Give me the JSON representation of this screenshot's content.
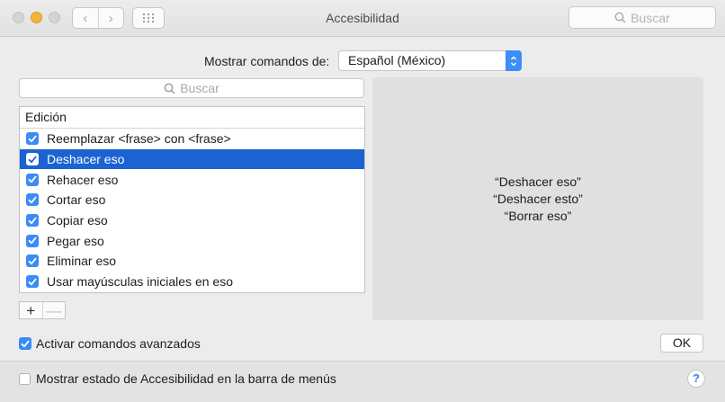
{
  "window": {
    "title": "Accesibilidad"
  },
  "toolbar": {
    "search_placeholder": "Buscar",
    "back_label": "‹",
    "forward_label": "›"
  },
  "commands": {
    "label": "Mostrar comandos de:",
    "language": "Español (México)"
  },
  "list_search": {
    "placeholder": "Buscar"
  },
  "list": {
    "header": "Edición",
    "items": [
      {
        "label": "Reemplazar <frase> con <frase>",
        "checked": true,
        "selected": false
      },
      {
        "label": "Deshacer eso",
        "checked": true,
        "selected": true
      },
      {
        "label": "Rehacer eso",
        "checked": true,
        "selected": false
      },
      {
        "label": "Cortar eso",
        "checked": true,
        "selected": false
      },
      {
        "label": "Copiar eso",
        "checked": true,
        "selected": false
      },
      {
        "label": "Pegar eso",
        "checked": true,
        "selected": false
      },
      {
        "label": "Eliminar eso",
        "checked": true,
        "selected": false
      },
      {
        "label": "Usar mayúsculas iniciales en eso",
        "checked": true,
        "selected": false
      }
    ]
  },
  "buttons": {
    "add": "+",
    "remove": "—",
    "ok": "OK",
    "help": "?"
  },
  "preview": {
    "lines": [
      "“Deshacer eso”",
      "“Deshacer esto”",
      "“Borrar eso”"
    ]
  },
  "advanced": {
    "label": "Activar comandos avanzados",
    "checked": true
  },
  "footer": {
    "menu_status_label": "Mostrar estado de Accesibilidad en la barra de menús",
    "checked": false
  },
  "colors": {
    "accent": "#3b8cf6",
    "selection": "#1b63d1"
  }
}
